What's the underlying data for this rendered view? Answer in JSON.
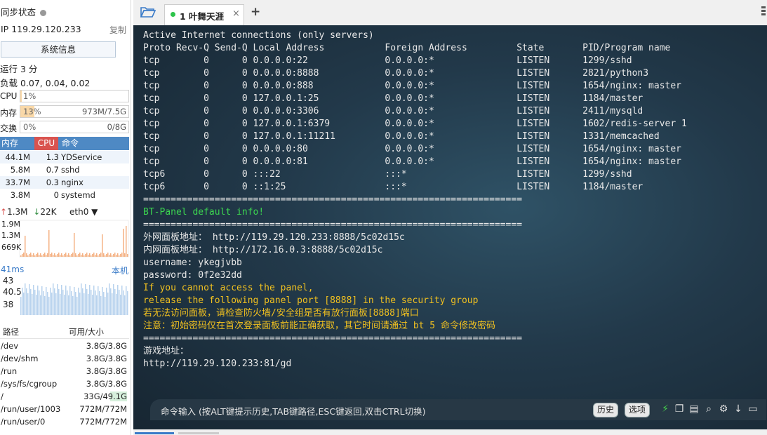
{
  "left": {
    "sync_status": "同步状态",
    "ip_label": "IP 119.29.120.233",
    "copy": "复制",
    "sysinfo_button": "系统信息",
    "uptime": "运行 3 分",
    "load": "负载 0.07, 0.04, 0.02",
    "cpu": {
      "label": "CPU",
      "value": "1%",
      "percent": 1
    },
    "mem": {
      "label": "内存",
      "value": "13%",
      "total": "973M/7.5G",
      "percent": 13
    },
    "swap": {
      "label": "交换",
      "value": "0%",
      "total": "0/8G",
      "percent": 0
    },
    "proc_headers": [
      "内存",
      "CPU",
      "命令"
    ],
    "processes": [
      {
        "mem": "44.1M",
        "cpu": "1.3",
        "cmd": "YDService"
      },
      {
        "mem": "5.8M",
        "cpu": "0.7",
        "cmd": "sshd"
      },
      {
        "mem": "33.7M",
        "cpu": "0.3",
        "cmd": "nginx"
      },
      {
        "mem": "3.8M",
        "cpu": "0",
        "cmd": "systemd"
      }
    ],
    "net": {
      "up": "1.3M",
      "down": "22K",
      "iface": "eth0",
      "ticks": [
        "1.9M",
        "1.3M",
        "669K"
      ]
    },
    "ping": {
      "ms": "41ms",
      "host": "本机",
      "ticks": [
        "43",
        "40.5",
        "38"
      ]
    },
    "fs_headers": [
      "路径",
      "可用/大小"
    ],
    "filesystems": [
      {
        "path": "/dev",
        "size": "3.8G/3.8G"
      },
      {
        "path": "/dev/shm",
        "size": "3.8G/3.8G"
      },
      {
        "path": "/run",
        "size": "3.8G/3.8G"
      },
      {
        "path": "/sys/fs/cgroup",
        "size": "3.8G/3.8G"
      },
      {
        "path": "/",
        "size": "33G/49.1G"
      },
      {
        "path": "/run/user/1003",
        "size": "772M/772M"
      },
      {
        "path": "/run/user/0",
        "size": "772M/772M"
      }
    ]
  },
  "tabs": [
    {
      "label": "1 叶舞天涯",
      "close": "×"
    }
  ],
  "new_tab": "+",
  "terminal": {
    "lines": [
      {
        "t": "Active Internet connections (only servers)",
        "c": ""
      },
      {
        "t": "Proto Recv-Q Send-Q Local Address           Foreign Address         State       PID/Program name",
        "c": ""
      },
      {
        "t": "tcp        0      0 0.0.0.0:22              0.0.0.0:*               LISTEN      1299/sshd",
        "c": ""
      },
      {
        "t": "tcp        0      0 0.0.0.0:8888            0.0.0.0:*               LISTEN      2821/python3",
        "c": ""
      },
      {
        "t": "tcp        0      0 0.0.0.0:888             0.0.0.0:*               LISTEN      1654/nginx: master",
        "c": ""
      },
      {
        "t": "tcp        0      0 127.0.0.1:25            0.0.0.0:*               LISTEN      1184/master",
        "c": ""
      },
      {
        "t": "tcp        0      0 0.0.0.0:3306            0.0.0.0:*               LISTEN      2411/mysqld",
        "c": ""
      },
      {
        "t": "tcp        0      0 127.0.0.1:6379          0.0.0.0:*               LISTEN      1602/redis-server 1",
        "c": ""
      },
      {
        "t": "tcp        0      0 127.0.0.1:11211         0.0.0.0:*               LISTEN      1331/memcached",
        "c": ""
      },
      {
        "t": "tcp        0      0 0.0.0.0:80              0.0.0.0:*               LISTEN      1654/nginx: master",
        "c": ""
      },
      {
        "t": "tcp        0      0 0.0.0.0:81              0.0.0.0:*               LISTEN      1654/nginx: master",
        "c": ""
      },
      {
        "t": "tcp6       0      0 :::22                   :::*                    LISTEN      1299/sshd",
        "c": ""
      },
      {
        "t": "tcp6       0      0 ::1:25                  :::*                    LISTEN      1184/master",
        "c": ""
      },
      {
        "t": "=====================================================================",
        "c": ""
      },
      {
        "t": "BT-Panel default info!",
        "c": "g"
      },
      {
        "t": "=====================================================================",
        "c": ""
      },
      {
        "t": "外网面板地址： http://119.29.120.233:8888/5c02d15c",
        "c": ""
      },
      {
        "t": "内网面板地址： http://172.16.0.3:8888/5c02d15c",
        "c": ""
      },
      {
        "t": "username: ykegjvbb",
        "c": ""
      },
      {
        "t": "password: 0f2e32dd",
        "c": ""
      },
      {
        "t": "If you cannot access the panel,",
        "c": "y"
      },
      {
        "t": "release the following panel port [8888] in the security group",
        "c": "y"
      },
      {
        "t": "若无法访问面板，请检查防火墙/安全组是否有放行面板[8888]端口",
        "c": "y"
      },
      {
        "t": "注意：初始密码仅在首次登录面板前能正确获取，其它时间请通过 bt 5 命令修改密码",
        "c": "y"
      },
      {
        "t": "=====================================================================",
        "c": ""
      },
      {
        "t": "游戏地址：",
        "c": ""
      },
      {
        "t": "http://119.29.120.233:81/gd",
        "c": ""
      }
    ]
  },
  "cmdbar": {
    "placeholder": "命令输入 (按ALT键提示历史,TAB键路径,ESC键返回,双击CTRL切换)",
    "history": "历史",
    "options": "选项"
  }
}
